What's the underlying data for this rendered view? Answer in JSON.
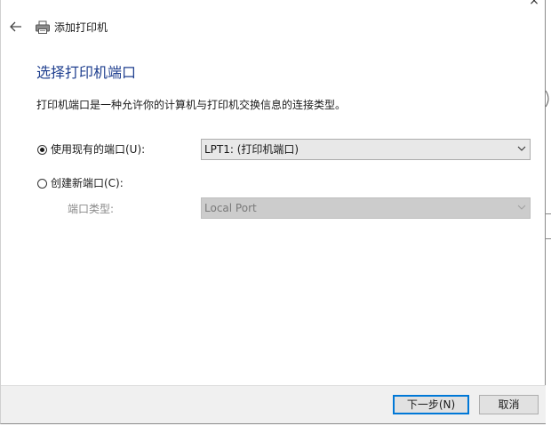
{
  "window": {
    "title": "添加打印机",
    "close_glyph": "×"
  },
  "page": {
    "heading": "选择打印机端口",
    "description": "打印机端口是一种允许你的计算机与打印机交换信息的连接类型。"
  },
  "options": {
    "existing_port": {
      "label": "使用现有的端口(U):",
      "selected": true,
      "value": "LPT1: (打印机端口)"
    },
    "new_port": {
      "label": "创建新端口(C):",
      "selected": false,
      "type_label": "端口类型:",
      "type_value": "Local Port"
    }
  },
  "footer": {
    "next_label": "下一步(N)",
    "cancel_label": "取消"
  },
  "icons": {
    "back": "back-arrow-icon",
    "printer": "printer-icon",
    "dropdown": "chevron-down-icon"
  },
  "colors": {
    "heading": "#1f3f8f",
    "default_button_border": "#0078d7"
  }
}
